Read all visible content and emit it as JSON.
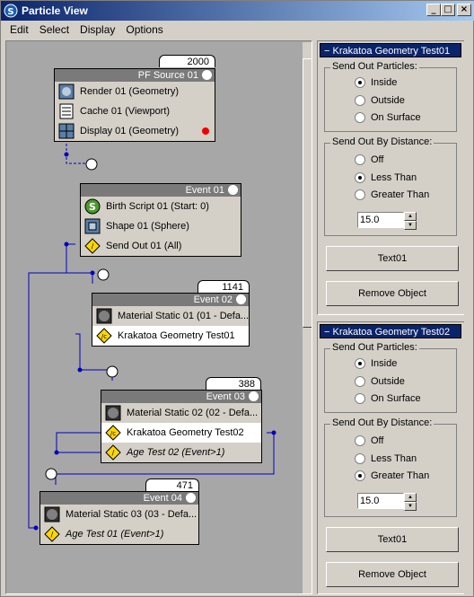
{
  "window": {
    "title": "Particle View"
  },
  "menu": [
    "Edit",
    "Select",
    "Display",
    "Options"
  ],
  "nodes": {
    "pf_source": {
      "count": "2000",
      "title": "PF Source 01",
      "rows": [
        "Render 01 (Geometry)",
        "Cache 01 (Viewport)",
        "Display 01 (Geometry)"
      ]
    },
    "event01": {
      "title": "Event 01",
      "rows": [
        "Birth Script 01 (Start: 0)",
        "Shape 01 (Sphere)",
        "Send Out 01 (All)"
      ]
    },
    "event02": {
      "count": "1141",
      "title": "Event 02",
      "rows": [
        "Material Static 01 (01 - Defa...",
        "Krakatoa Geometry Test01"
      ]
    },
    "event03": {
      "count": "388",
      "title": "Event 03",
      "rows": [
        "Material Static 02 (02 - Defa...",
        "Krakatoa Geometry Test02",
        "Age Test 02 (Event>1)"
      ]
    },
    "event04": {
      "count": "471",
      "title": "Event 04",
      "rows": [
        "Material Static 03 (03 - Defa...",
        "Age Test 01 (Event>1)"
      ]
    }
  },
  "rollouts": [
    {
      "header": "Krakatoa Geometry Test01",
      "send_out_particles": {
        "label": "Send Out Particles:",
        "options": [
          "Inside",
          "Outside",
          "On Surface"
        ],
        "selected": "Inside"
      },
      "send_out_by_distance": {
        "label": "Send Out By Distance:",
        "options": [
          "Off",
          "Less Than",
          "Greater Than"
        ],
        "selected": "Less Than",
        "value": "15.0"
      },
      "text_button": "Text01",
      "remove_button": "Remove Object"
    },
    {
      "header": "Krakatoa Geometry Test02",
      "send_out_particles": {
        "label": "Send Out Particles:",
        "options": [
          "Inside",
          "Outside",
          "On Surface"
        ],
        "selected": "Inside"
      },
      "send_out_by_distance": {
        "label": "Send Out By Distance:",
        "options": [
          "Off",
          "Less Than",
          "Greater Than"
        ],
        "selected": "Greater Than",
        "value": "15.0"
      },
      "text_button": "Text01",
      "remove_button": "Remove Object"
    }
  ],
  "colors": {
    "wire": "#0000c0",
    "title_bar": "#0a246a",
    "node_header": "#7a7a7a",
    "canvas": "#a7a7a7",
    "test_icon": "#ffd700",
    "material_icon": "#303030"
  }
}
